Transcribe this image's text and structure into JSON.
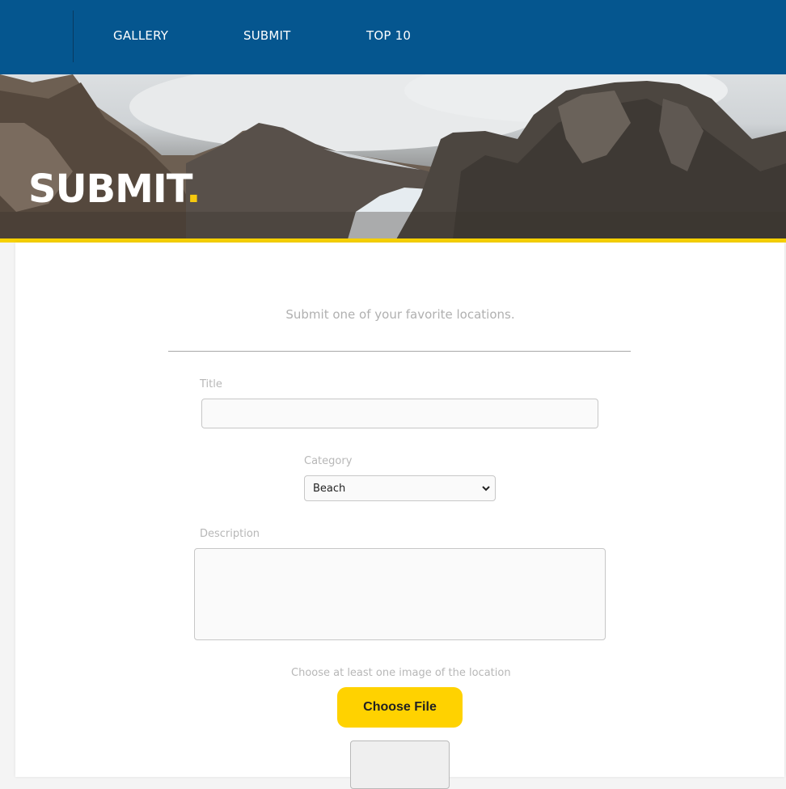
{
  "nav": {
    "items": [
      {
        "label": "GALLERY"
      },
      {
        "label": "SUBMIT"
      },
      {
        "label": "TOP 10"
      }
    ]
  },
  "hero": {
    "title": "SUBMIT",
    "dot": ".",
    "accent_color": "#f6c90e"
  },
  "form": {
    "intro": "Submit one of your favorite locations.",
    "title_label": "Title",
    "title_value": "",
    "category_label": "Category",
    "category_value": "Beach",
    "description_label": "Description",
    "description_value": "",
    "image_label": "Choose at least one image of the location",
    "file_button_label": "Choose File"
  },
  "colors": {
    "nav_background": "#05568f",
    "accent_yellow": "#ffd200"
  }
}
